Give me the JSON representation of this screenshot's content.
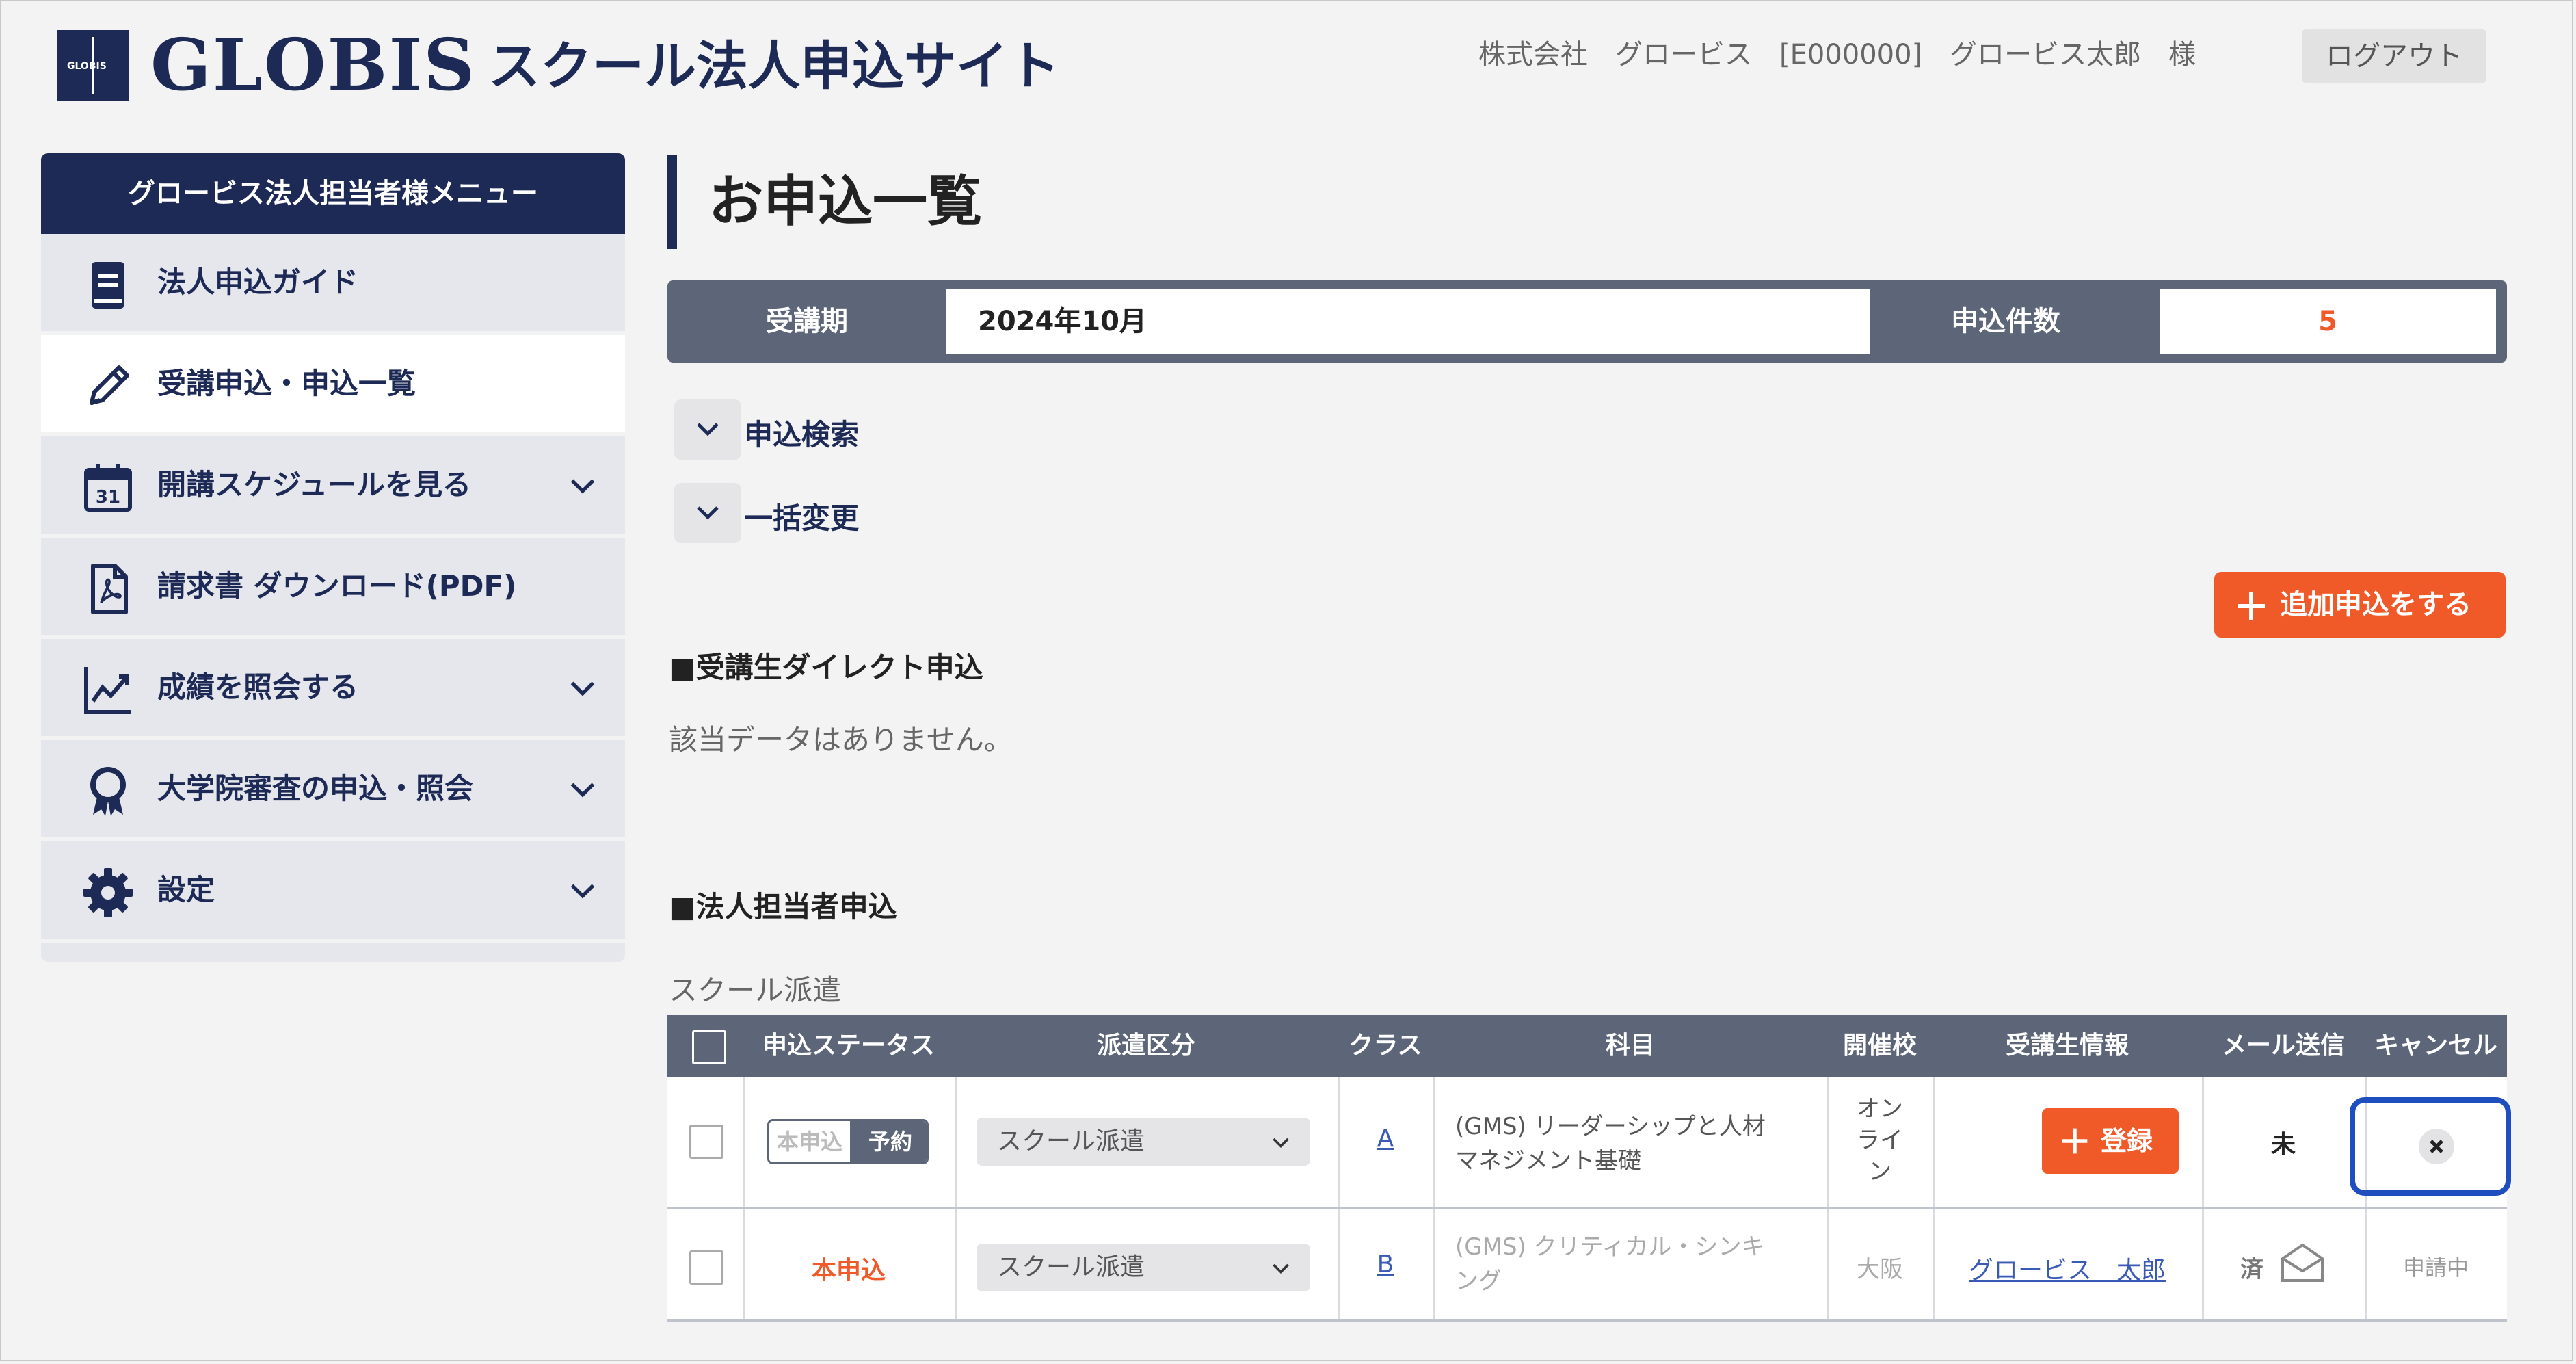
{
  "header": {
    "logo_text": "GLOBIS",
    "logo_mini": "GLOBIS",
    "site_title": "スクール法人申込サイト",
    "user_info": "株式会社　グロービス　[E000000]　グロービス太郎　様",
    "logout_label": "ログアウト"
  },
  "sidebar": {
    "heading": "グロービス法人担当者様メニュー",
    "items": [
      {
        "label": "法人申込ガイド",
        "icon": "book-icon"
      },
      {
        "label": "受講申込・申込一覧",
        "icon": "pencil-icon"
      },
      {
        "label": "開講スケジュールを見る",
        "icon": "calendar-icon",
        "calendar_day": "31"
      },
      {
        "label": "請求書 ダウンロード(PDF)",
        "icon": "pdf-icon"
      },
      {
        "label": "成績を照会する",
        "icon": "chart-icon"
      },
      {
        "label": "大学院審査の申込・照会",
        "icon": "award-icon"
      },
      {
        "label": "設定",
        "icon": "gear-icon"
      }
    ]
  },
  "main": {
    "title": "お申込一覧",
    "period_label": "受講期",
    "period_value": "2024年10月",
    "count_label": "申込件数",
    "count_value": "5",
    "search_label": "申込検索",
    "bulk_label": "一括変更",
    "add_button": "追加申込をする",
    "direct_heading": "■受講生ダイレクト申込",
    "no_data": "該当データはありません。",
    "corp_heading": "■法人担当者申込",
    "school_dispatch": "スクール派遣"
  },
  "table": {
    "headers": [
      "申込ステータス",
      "派遣区分",
      "クラス",
      "科目",
      "開催校",
      "受講生情報",
      "メール送信",
      "キャンセル"
    ],
    "rows": [
      {
        "status_off": "本申込",
        "status_on": "予約",
        "dispatch": "スクール派遣",
        "class": "A",
        "subject_line1": "(GMS) リーダーシップと人材",
        "subject_line2": "マネジメント基礎",
        "venue_lines": [
          "オン",
          "ライ",
          "ン"
        ],
        "register_label": "登録",
        "mail": "未"
      },
      {
        "status": "本申込",
        "dispatch": "スクール派遣",
        "class": "B",
        "subject_line1": "(GMS) クリティカル・シンキ",
        "subject_line2": "ング",
        "venue": "大阪",
        "student": "グロービス　太郎",
        "mail": "済",
        "cancel": "申請中"
      }
    ]
  },
  "colors": {
    "navy": "#1e2a56",
    "slate": "#5d6578",
    "accent": "#f05a28",
    "highlight": "#1f4fbf"
  }
}
